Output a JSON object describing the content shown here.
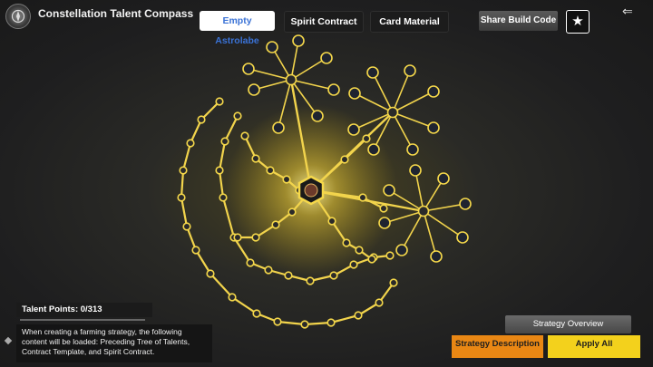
{
  "header": {
    "title": "Constellation Talent Compass",
    "tabs": [
      {
        "label": "Empty Astrolabe",
        "active": true
      },
      {
        "label": "Spirit Contract",
        "active": false
      },
      {
        "label": "Card Material",
        "active": false
      }
    ],
    "share_label": "Share Build Code",
    "star_glyph": "★",
    "back_glyph": "⇐"
  },
  "talent_points": {
    "label": "Talent Points: 0/313"
  },
  "info_text": "When creating a farming strategy, the following content will be loaded: Preceding Tree of Talents, Contract Template, and Spirit Contract.",
  "footer": {
    "overview_label": "Strategy Overview",
    "strategy_label": "Strategy Description",
    "apply_label": "Apply All"
  },
  "colors": {
    "accent_gold": "#f3d11c",
    "accent_orange": "#e98714",
    "tab_active_text": "#3a72d6"
  }
}
